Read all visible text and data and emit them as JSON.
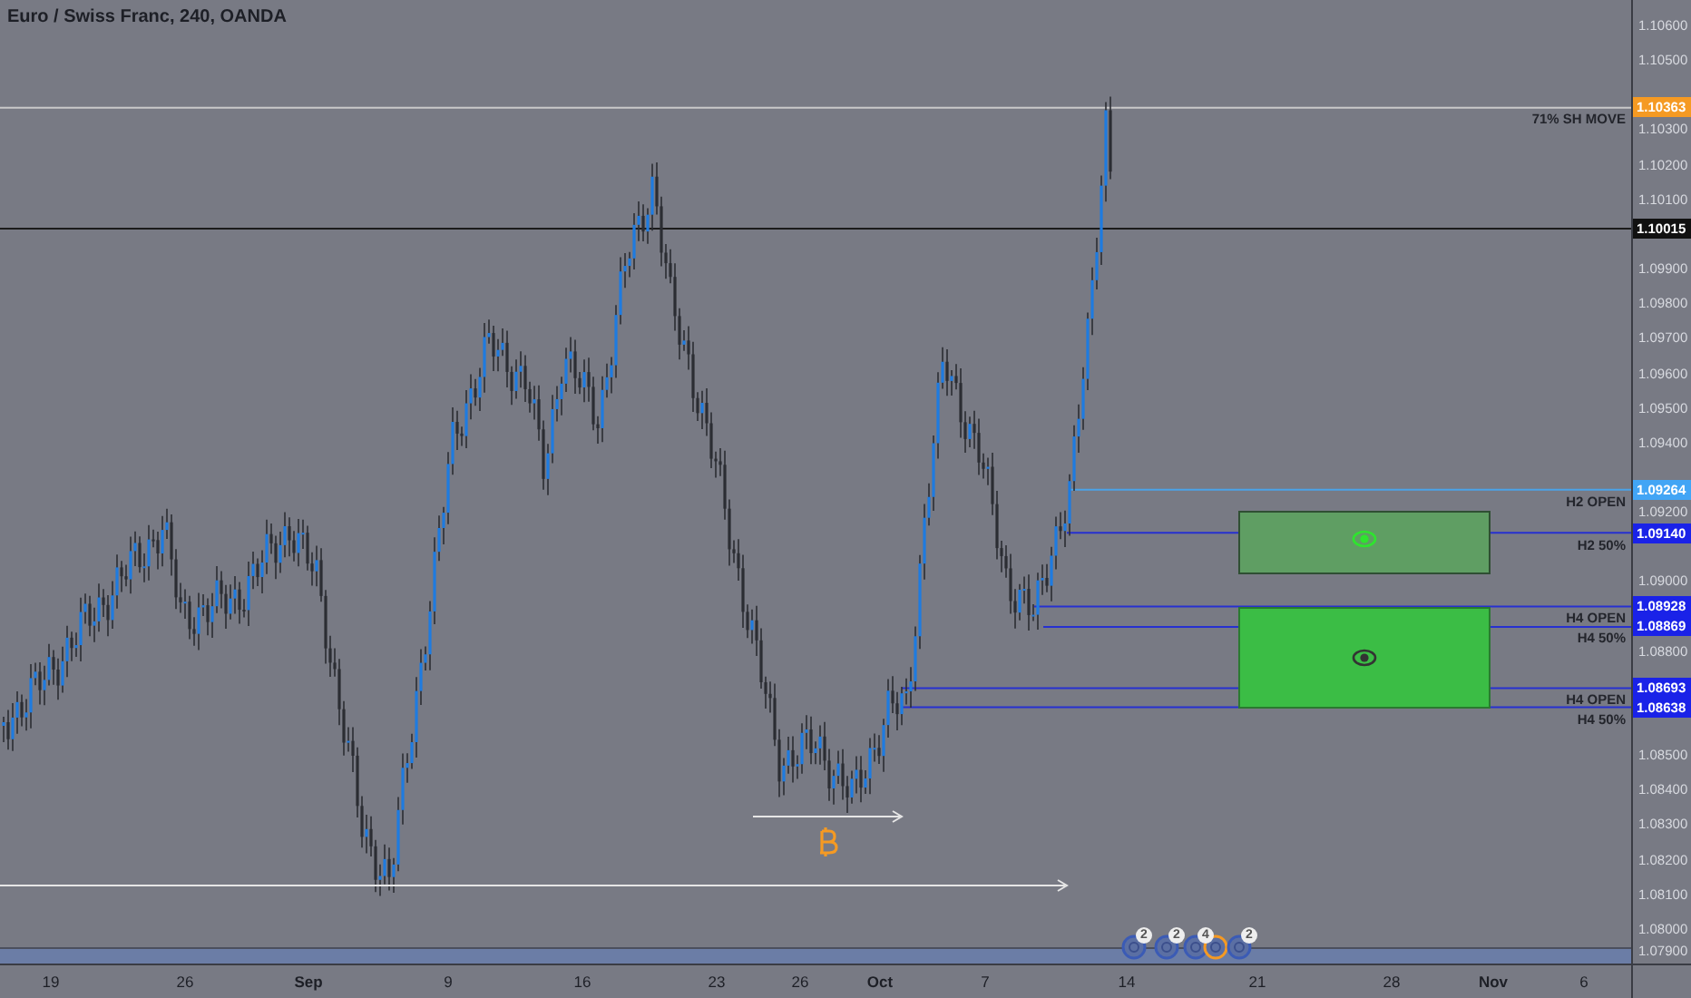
{
  "title": "Euro / Swiss Franc, 240, OANDA",
  "levels": [
    {
      "label": "71% SH MOVE",
      "price": "1.10363",
      "kind": "orange"
    },
    {
      "price": "1.10015",
      "kind": "last"
    },
    {
      "label": "H2 OPEN",
      "price": "1.09264",
      "kind": "light"
    },
    {
      "label": "H2 50%",
      "price": "1.09140",
      "kind": "blue"
    },
    {
      "label": "H4 OPEN",
      "price": "1.08928",
      "kind": "blue"
    },
    {
      "label": "H4 50%",
      "price": "1.08869",
      "kind": "blue"
    },
    {
      "label": "H4 OPEN",
      "price": "1.08693",
      "kind": "blue"
    },
    {
      "label": "H4 50%",
      "price": "1.08638",
      "kind": "blue"
    }
  ],
  "zones": [
    {
      "kind": "faded"
    },
    {
      "kind": "bright"
    }
  ],
  "price_ticks": [
    "1.10600",
    "1.10500",
    "1.10300",
    "1.10200",
    "1.10100",
    "1.09900",
    "1.09800",
    "1.09700",
    "1.09600",
    "1.09500",
    "1.09400",
    "1.09200",
    "1.09000",
    "1.08800",
    "1.08500",
    "1.08400",
    "1.08300",
    "1.08200",
    "1.08100",
    "1.08000",
    "1.07900"
  ],
  "time_ticks": [
    {
      "label": "19",
      "kind": "day"
    },
    {
      "label": "26",
      "kind": "day"
    },
    {
      "label": "Sep",
      "kind": "month"
    },
    {
      "label": "9",
      "kind": "day"
    },
    {
      "label": "16",
      "kind": "day"
    },
    {
      "label": "23",
      "kind": "day"
    },
    {
      "label": "26",
      "kind": "day"
    },
    {
      "label": "Oct",
      "kind": "month"
    },
    {
      "label": "7",
      "kind": "day"
    },
    {
      "label": "14",
      "kind": "day"
    },
    {
      "label": "21",
      "kind": "day"
    },
    {
      "label": "28",
      "kind": "day"
    },
    {
      "label": "Nov",
      "kind": "month"
    },
    {
      "label": "6",
      "kind": "day"
    }
  ],
  "events": [
    {
      "kind": "blue",
      "count": "2"
    },
    {
      "kind": "blue",
      "count": "2"
    },
    {
      "kind": "blue",
      "count": "4"
    },
    {
      "kind": "orange"
    },
    {
      "kind": "blue",
      "count": "2"
    }
  ]
}
